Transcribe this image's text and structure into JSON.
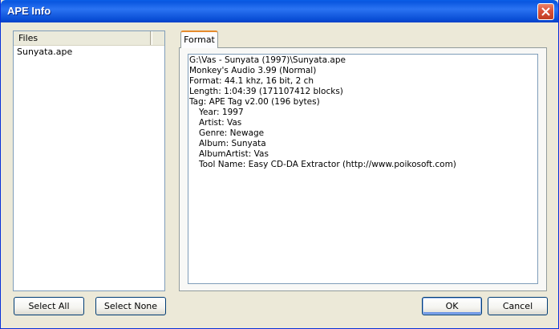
{
  "window": {
    "title": "APE Info"
  },
  "files": {
    "header": "Files",
    "items": [
      "Sunyata.ape"
    ]
  },
  "tabs": [
    {
      "label": "Format",
      "active": true
    }
  ],
  "info": {
    "lines": [
      {
        "text": "G:\\Vas - Sunyata (1997)\\Sunyata.ape",
        "indent": false
      },
      {
        "text": "Monkey's Audio 3.99 (Normal)",
        "indent": false
      },
      {
        "text": "Format: 44.1 khz, 16 bit, 2 ch",
        "indent": false
      },
      {
        "text": "Length: 1:04:39 (171107412 blocks)",
        "indent": false
      },
      {
        "text": "Tag: APE Tag v2.00 (196 bytes)",
        "indent": false
      },
      {
        "text": "Year: 1997",
        "indent": true
      },
      {
        "text": "Artist: Vas",
        "indent": true
      },
      {
        "text": "Genre: Newage",
        "indent": true
      },
      {
        "text": "Album: Sunyata",
        "indent": true
      },
      {
        "text": "AlbumArtist: Vas",
        "indent": true
      },
      {
        "text": "Tool Name: Easy CD-DA Extractor (http://www.poikosoft.com)",
        "indent": true
      }
    ]
  },
  "buttons": {
    "select_all": "Select All",
    "select_none": "Select None",
    "ok": "OK",
    "cancel": "Cancel"
  },
  "colors": {
    "titlebar": "#0a56e0",
    "close_button": "#d9513a",
    "dialog_bg": "#ece9d8",
    "tab_highlight": "#e68b2c"
  }
}
